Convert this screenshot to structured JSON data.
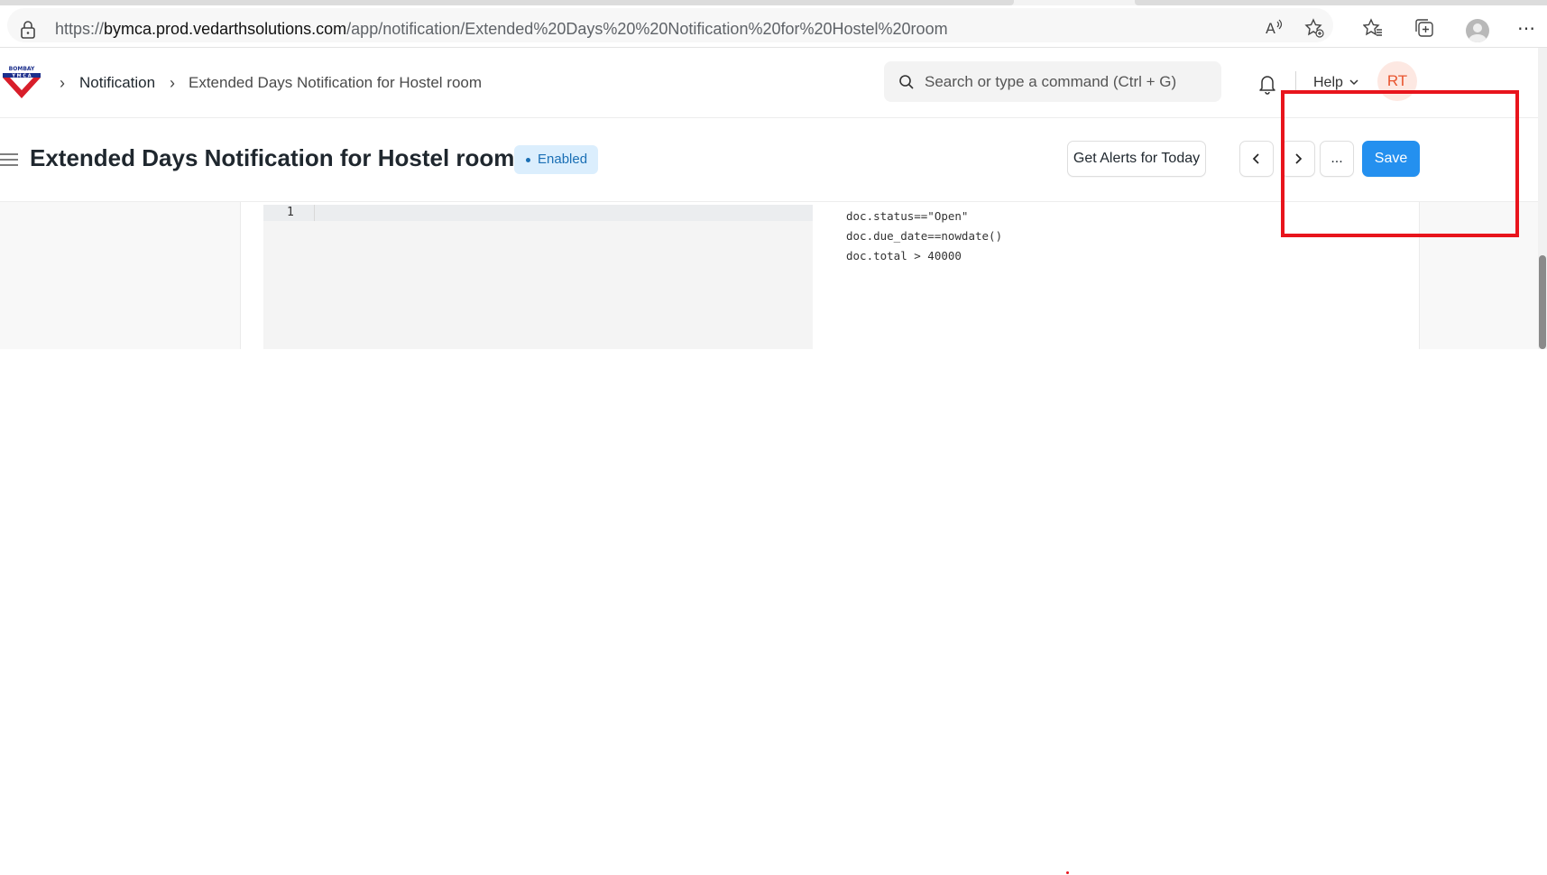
{
  "browser": {
    "url_prefix": "https://",
    "url_host": "bymca.prod.vedarthsolutions.com",
    "url_path": "/app/notification/Extended%20Days%20%20Notification%20for%20Hostel%20room"
  },
  "navbar": {
    "breadcrumbs": [
      "Notification",
      "Extended Days Notification for Hostel room"
    ],
    "search_placeholder": "Search or type a command (Ctrl + G)",
    "help_label": "Help",
    "user_initials": "RT",
    "logo_text": "BOMBAY YMCA"
  },
  "page": {
    "title": "Extended Days Notification for Hostel room",
    "status_badge": "Enabled",
    "actions": {
      "alerts_label": "Get Alerts for Today",
      "more_label": "...",
      "save_label": "Save"
    }
  },
  "editor": {
    "line_number": "1",
    "examples": [
      "doc.status==\"Open\"",
      "doc.due_date==nowdate()",
      "doc.total > 40000"
    ]
  },
  "colors": {
    "primary": "#2490ef",
    "badge_bg": "#dbeefd",
    "avatar_bg": "#fde8e2",
    "avatar_text": "#e8542e",
    "highlight": "#e8141c"
  }
}
